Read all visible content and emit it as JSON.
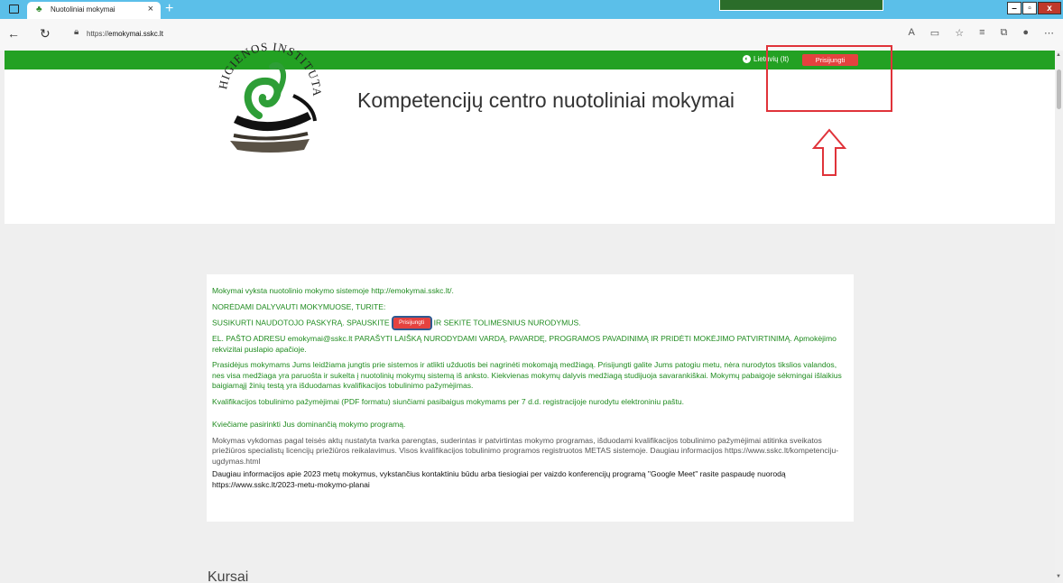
{
  "browser": {
    "tab_title": "Nuotoliniai mokymai",
    "tab_close": "×",
    "new_tab": "+",
    "url_prefix": "https://",
    "url_host": "emokymai.sskc.lt",
    "win_min": "–",
    "win_max": "▫",
    "win_close": "x"
  },
  "topbar": {
    "language": "Lietuvių (lt)",
    "login_label": "Prisijungti"
  },
  "header": {
    "title": "Kompetencijų centro nuotoliniai mokymai",
    "logo_top_text": "HIGIENOS INSTITUTAS"
  },
  "info": {
    "p1": "Mokymai vyksta nuotolinio mokymo sistemoje http://emokymai.sskc.lt/.",
    "p2": "NORĖDAMI DALYVAUTI MOKYMUOSE, TURITE:",
    "p3_before": "SUSIKURTI NAUDOTOJO PASKYRĄ. SPAUSKITE",
    "p3_button": "Prisijungti",
    "p3_after": "IR SEKITE TOLIMESNIUS NURODYMUS.",
    "p4": "EL. PAŠTO ADRESU emokymai@sskc.lt  PARAŠYTI LAIŠKĄ NURODYDAMI VARDĄ, PAVARDĘ, PROGRAMOS PAVADINIMĄ IR PRIDĖTI MOKĖJIMO PATVIRTINIMĄ.  Apmokėjimo rekvizitai puslapio apačioje.",
    "p5": "Prasidėjus mokymams Jums leidžiama jungtis prie sistemos ir atlikti užduotis bei nagrinėti mokomąją medžiagą. Prisijungti galite Jums patogiu metu, nėra nurodytos tikslios valandos, nes visa medžiaga yra paruošta ir sukelta į nuotolinių mokymų sistemą iš anksto. Kiekvienas mokymų dalyvis medžiagą studijuoja savarankiškai. Mokymų pabaigoje sėkmingai išlaikius baigiamąjį žinių testą yra išduodamas kvalifikacijos tobulinimo pažymėjimas.",
    "p6": "Kvalifikacijos tobulinimo pažymėjimai (PDF formatu) siunčiami pasibaigus mokymams per 7 d.d. registracijoje nurodytu elektroniniu paštu.",
    "p7": "Kviečiame pasirinkti Jus dominančią mokymo programą.",
    "p8": "Mokymas vykdomas pagal teisės aktų nustatyta tvarka parengtas, suderintas ir patvirtintas mokymo programas, išduodami kvalifikacijos tobulinimo pažymėjimai atitinka sveikatos priežiūros specialistų licencijų priežiūros reikalavimus. Visos kvalifikacijos tobulinimo programos registruotos METAS sistemoje. Daugiau informacijos https://www.sskc.lt/kompetenciju-ugdymas.html",
    "p9": "Daugiau informacijos apie 2023 metų mokymus, vykstančius kontaktiniu būdu arba tiesiogiai per vaizdo konferencijų programą \"Google Meet\" rasite paspaudę nuorodą https://www.sskc.lt/2023-metu-mokymo-planai"
  },
  "courses_heading": "Kursai",
  "colors": {
    "green_bar": "#23a123",
    "login_red": "#e5423f",
    "annotation_red": "#e0333a",
    "text_green": "#1f8b1f"
  }
}
